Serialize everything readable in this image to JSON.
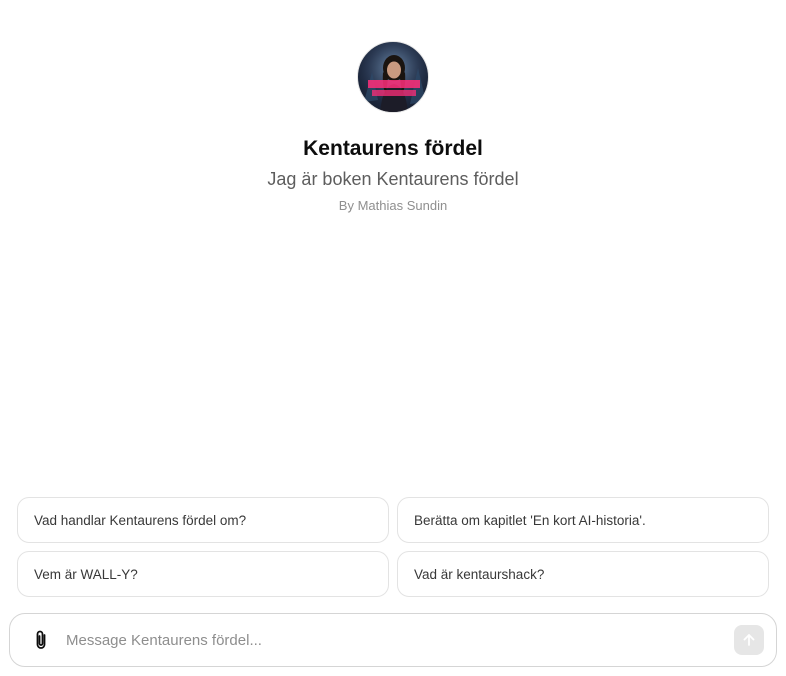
{
  "gpt": {
    "name": "Kentaurens fördel",
    "description": "Jag är boken Kentaurens fördel",
    "author": "By Mathias Sundin",
    "avatar_icon": "book-cover-avatar"
  },
  "suggestions": [
    "Vad handlar Kentaurens fördel om?",
    "Berätta om kapitlet 'En kort AI-historia'.",
    "Vem är WALL-Y?",
    "Vad är kentaurshack?"
  ],
  "composer": {
    "placeholder": "Message Kentaurens fördel...",
    "value": "",
    "attach_icon": "paperclip-icon",
    "send_icon": "arrow-up-icon"
  },
  "colors": {
    "text": "#0d0d0d",
    "muted": "#5d5d5d",
    "byline": "#8f8f8f",
    "border": "#e3e3e3",
    "send_disabled": "#e6e6e6"
  }
}
